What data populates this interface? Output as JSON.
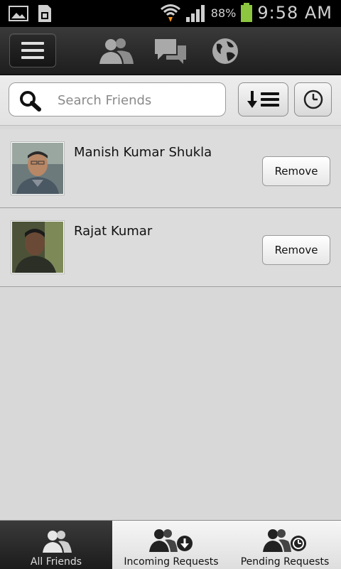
{
  "status_bar": {
    "battery_percent": "88%",
    "time": "9:58 AM",
    "icons": [
      "gallery-icon",
      "sim-icon",
      "wifi-icon",
      "signal-icon",
      "battery-icon"
    ]
  },
  "action_bar": {
    "icons": [
      "menu-icon",
      "friends-icon",
      "chat-icon",
      "globe-icon"
    ]
  },
  "search": {
    "placeholder": "Search Friends",
    "value": ""
  },
  "toolbar": {
    "icons": [
      "sort-icon",
      "clock-icon"
    ]
  },
  "friends": [
    {
      "name": "Manish Kumar Shukla",
      "action": "Remove"
    },
    {
      "name": "Rajat Kumar",
      "action": "Remove"
    }
  ],
  "tabs": [
    {
      "label": "All Friends",
      "active": true,
      "icon": "friends-icon"
    },
    {
      "label": "Incoming Requests",
      "active": false,
      "icon": "incoming-requests-icon"
    },
    {
      "label": "Pending Requests",
      "active": false,
      "icon": "pending-requests-icon"
    }
  ],
  "colors": {
    "accent_battery": "#8dc63f",
    "background": "#d8d8d8",
    "action_bar": "#2a2a2a"
  }
}
